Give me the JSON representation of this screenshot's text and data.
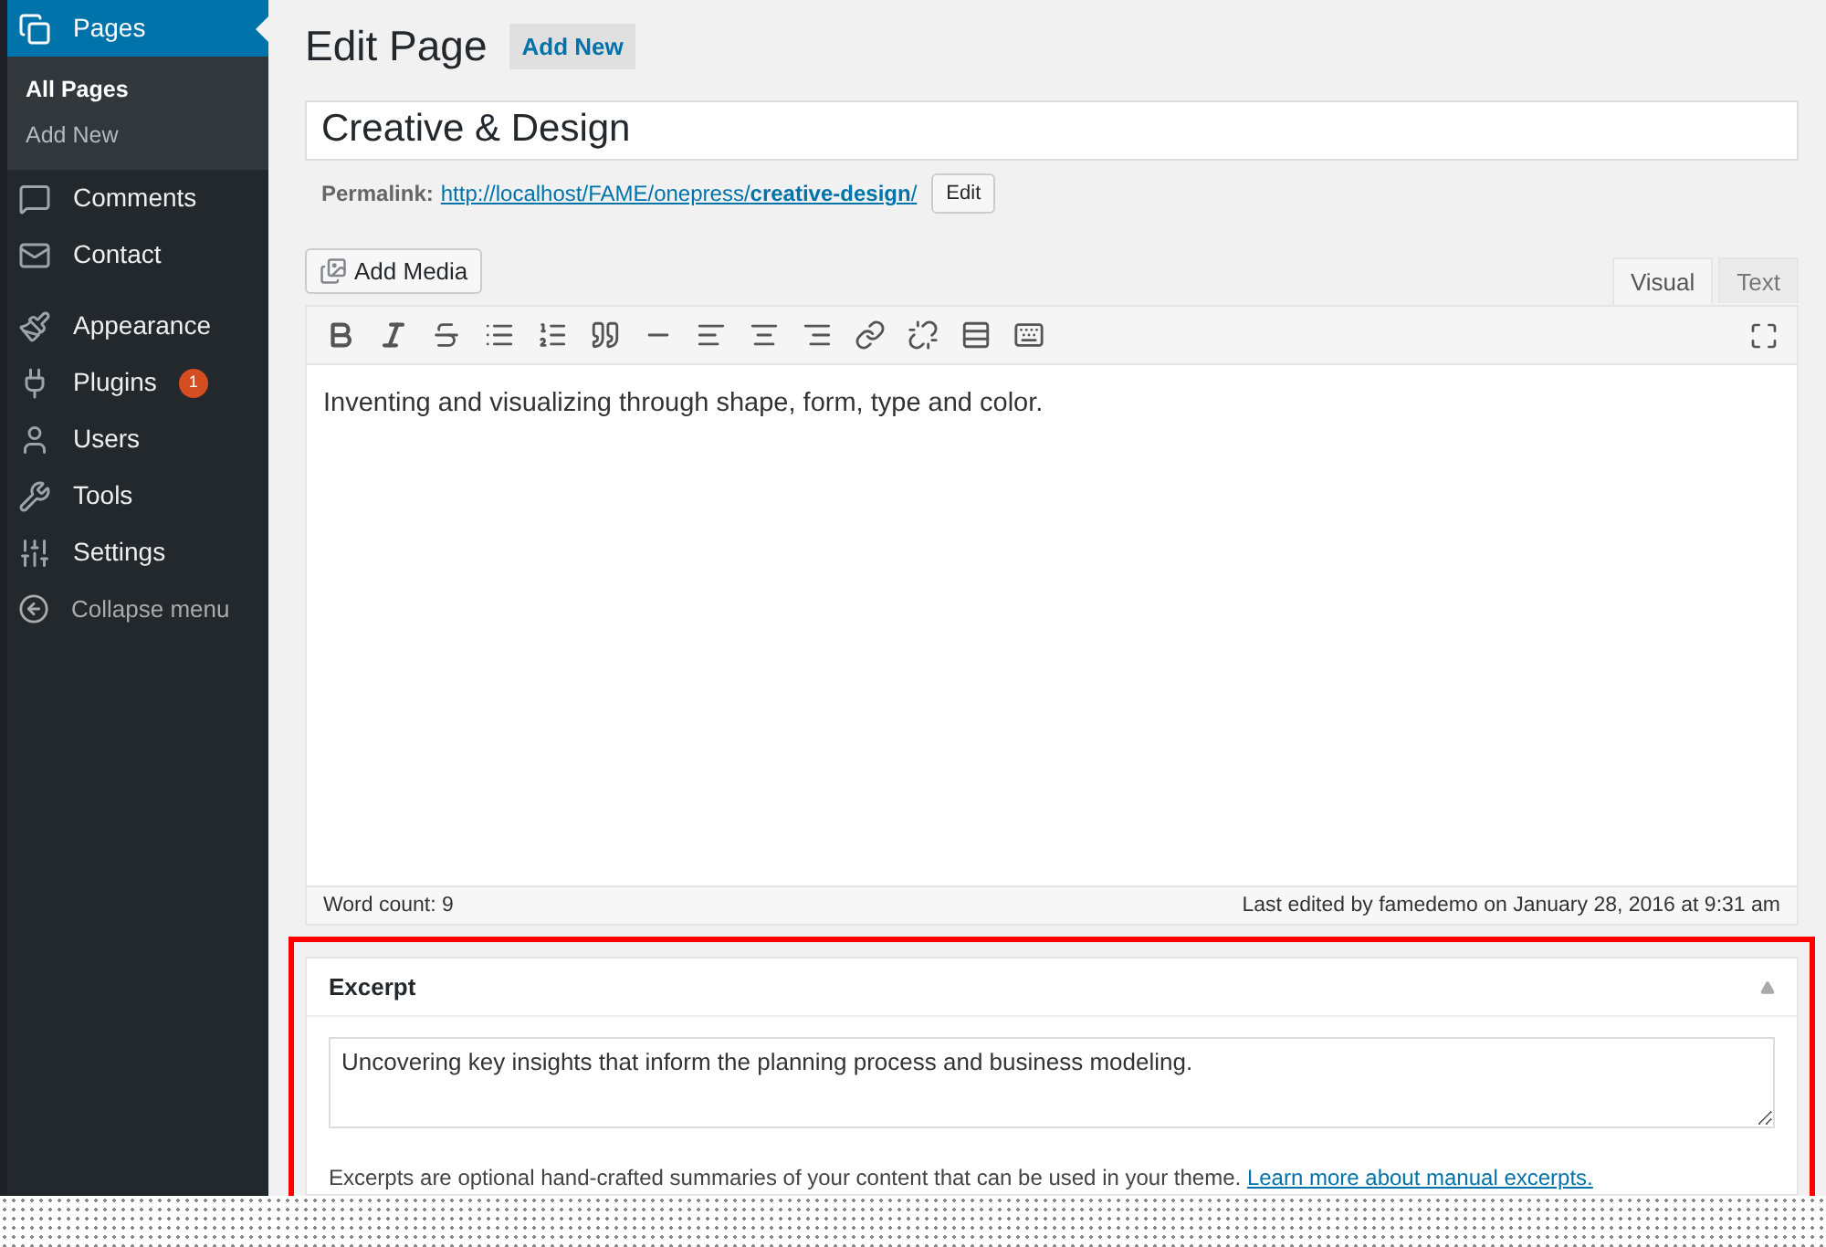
{
  "sidebar": {
    "items": [
      {
        "label": "Pages",
        "selected": true,
        "children": [
          {
            "label": "All Pages",
            "selected": true
          },
          {
            "label": "Add New",
            "selected": false
          }
        ]
      },
      {
        "label": "Comments",
        "selected": false
      },
      {
        "label": "Contact",
        "selected": false
      },
      {
        "label": "Appearance",
        "selected": false
      },
      {
        "label": "Plugins",
        "selected": false,
        "badge": "1"
      },
      {
        "label": "Users",
        "selected": false
      },
      {
        "label": "Tools",
        "selected": false
      },
      {
        "label": "Settings",
        "selected": false
      }
    ],
    "collapse": "Collapse menu"
  },
  "header": {
    "title": "Edit Page",
    "add_new": "Add New"
  },
  "title_field": {
    "value": "Creative & Design"
  },
  "permalink": {
    "label": "Permalink:",
    "url_prefix": "http://localhost/FAME/onepress/",
    "slug": "creative-design",
    "url_suffix": "/",
    "edit": "Edit"
  },
  "add_media": "Add Media",
  "editor_tabs": [
    {
      "label": "Visual",
      "selected": true
    },
    {
      "label": "Text",
      "selected": false
    }
  ],
  "editor": {
    "content": "Inventing and visualizing through shape, form, type and color.",
    "word_count": "Word count: 9",
    "last_edited": "Last edited by famedemo on January 28, 2016 at 9:31 am"
  },
  "excerpt": {
    "title": "Excerpt",
    "value": "Uncovering key insights that inform the planning process and business modeling.",
    "help": "Excerpts are optional hand-crafted summaries of your content that can be used in your theme.",
    "link": "Learn more about manual excerpts.",
    "highlighted": true
  }
}
